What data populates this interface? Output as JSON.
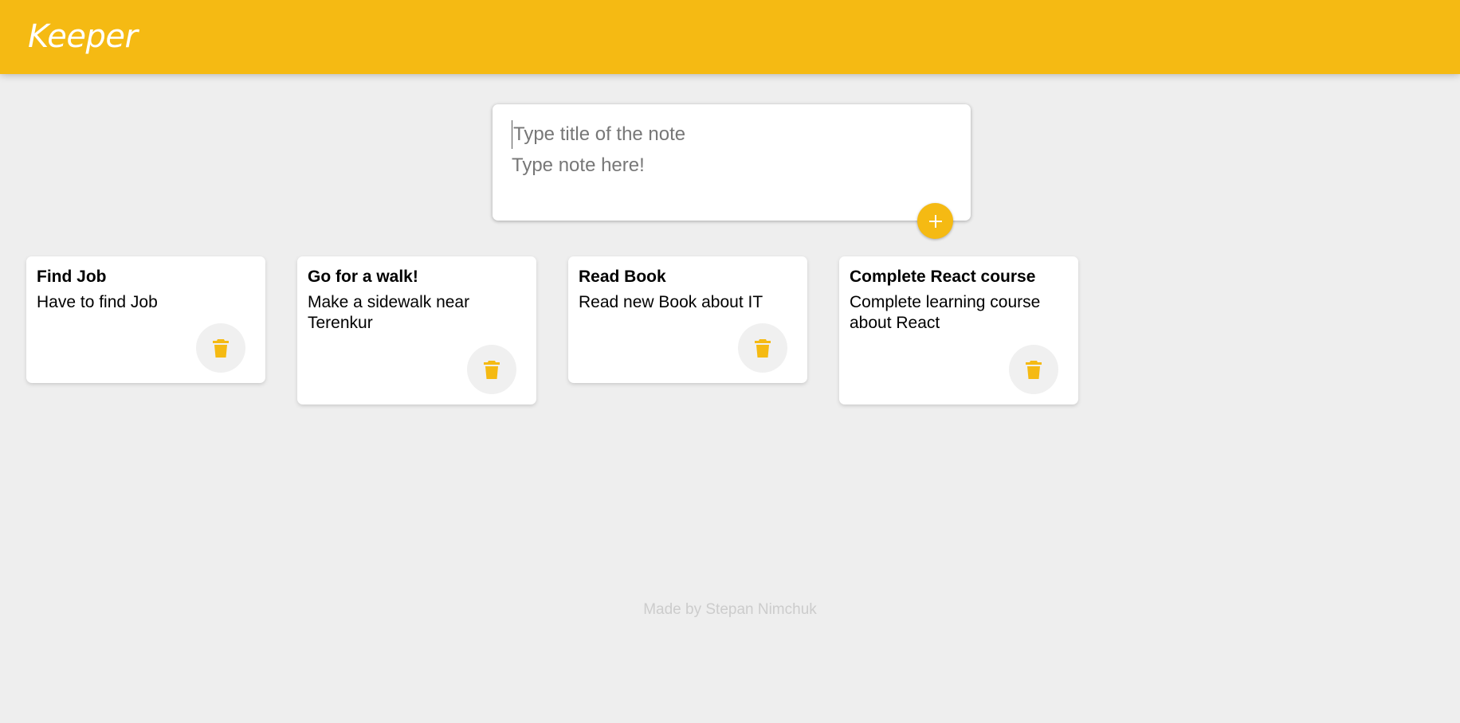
{
  "header": {
    "title": "Keeper"
  },
  "create_form": {
    "title_placeholder": "Type title of the note",
    "content_placeholder": "Type note here!",
    "add_icon": "plus-icon"
  },
  "notes": [
    {
      "title": "Find Job",
      "content": "Have to find Job",
      "delete_icon": "trash-icon"
    },
    {
      "title": "Go for a walk!",
      "content": "Make a sidewalk near Terenkur",
      "delete_icon": "trash-icon"
    },
    {
      "title": "Read Book",
      "content": "Read new Book about IT",
      "delete_icon": "trash-icon"
    },
    {
      "title": "Complete React course",
      "content": "Complete learning course about React",
      "delete_icon": "trash-icon"
    }
  ],
  "footer": {
    "text": "Made by Stepan Nimchuk"
  },
  "colors": {
    "accent": "#f5ba13",
    "background": "#eeeeee",
    "card": "#ffffff",
    "footer_text": "#cccccc"
  }
}
